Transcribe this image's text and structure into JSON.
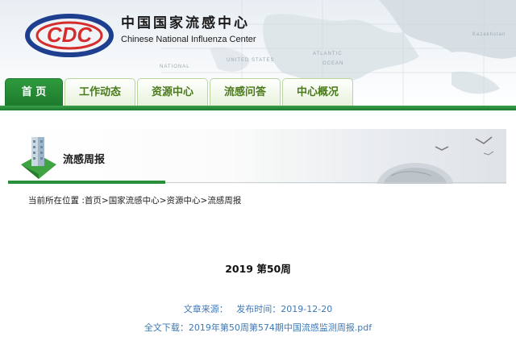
{
  "header": {
    "title_cn": "中国国家流感中心",
    "title_en": "Chinese National Influenza Center",
    "map_labels": [
      "NATIONAL",
      "UNITED STATES",
      "ATLANTIC",
      "OCEAN",
      "Kazakhstan"
    ]
  },
  "nav": {
    "items": [
      {
        "label": "首 页"
      },
      {
        "label": "工作动态"
      },
      {
        "label": "资源中心"
      },
      {
        "label": "流感问答"
      },
      {
        "label": "中心概况"
      }
    ]
  },
  "banner": {
    "title": "流感周报"
  },
  "breadcrumb": {
    "prefix": "当前所在位置 :",
    "links": [
      "首页",
      "国家流感中心",
      "资源中心",
      "流感周报"
    ],
    "separator": ">"
  },
  "article": {
    "title": "2019 第50周",
    "source_label": "文章来源：",
    "date_label": "发布时间：",
    "date": "2019-12-20",
    "download_label": "全文下载：",
    "download_file": "2019年第50周第574期中国流感监测周报.pdf"
  },
  "colors": {
    "nav_green": "#1c7a2c",
    "link_blue": "#3f78b4",
    "logo_blue": "#1e3f8f",
    "logo_red": "#d62c2c"
  }
}
